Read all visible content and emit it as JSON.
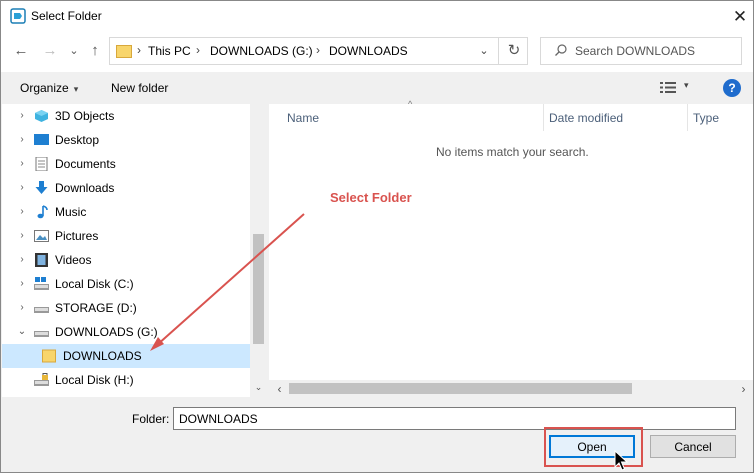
{
  "window": {
    "title": "Select Folder",
    "close_glyph": "✕"
  },
  "nav": {
    "back": "←",
    "forward": "→",
    "history": "⌄",
    "up": "↑",
    "breadcrumbs": [
      "This PC",
      "DOWNLOADS (G:)",
      "DOWNLOADS"
    ],
    "separator": "›",
    "address_drop": "⌄",
    "refresh": "↻",
    "search_placeholder": "Search DOWNLOADS"
  },
  "toolbar": {
    "organize": "Organize",
    "organize_caret": "▾",
    "new_folder": "New folder",
    "view_caret": "▾",
    "help": "?"
  },
  "tree": [
    {
      "label": "3D Objects",
      "icon": "3d-objects-icon",
      "expander": "›"
    },
    {
      "label": "Desktop",
      "icon": "desktop-icon",
      "expander": "›"
    },
    {
      "label": "Documents",
      "icon": "documents-icon",
      "expander": "›"
    },
    {
      "label": "Downloads",
      "icon": "downloads-icon",
      "expander": "›"
    },
    {
      "label": "Music",
      "icon": "music-icon",
      "expander": "›"
    },
    {
      "label": "Pictures",
      "icon": "pictures-icon",
      "expander": "›"
    },
    {
      "label": "Videos",
      "icon": "videos-icon",
      "expander": "›"
    },
    {
      "label": "Local Disk (C:)",
      "icon": "drive-icon",
      "expander": "›"
    },
    {
      "label": "STORAGE (D:)",
      "icon": "drive-icon",
      "expander": "›"
    },
    {
      "label": "DOWNLOADS (G:)",
      "icon": "drive-icon",
      "expander": "⌄"
    },
    {
      "label": "DOWNLOADS",
      "icon": "folder-icon",
      "expander": "",
      "selected": true
    },
    {
      "label": "Local Disk (H:)",
      "icon": "locked-drive-icon",
      "expander": ""
    }
  ],
  "columns": {
    "name": "Name",
    "date_modified": "Date modified",
    "type": "Type",
    "sort_caret": "^"
  },
  "empty_message": "No items match your search.",
  "annotation": {
    "callout": "Select Folder",
    "color": "#d9534f"
  },
  "footer": {
    "folder_label": "Folder:",
    "folder_value": "DOWNLOADS",
    "open": "Open",
    "cancel": "Cancel"
  },
  "scroll": {
    "up": "⌃",
    "down": "⌄",
    "left": "‹",
    "right": "›"
  },
  "colors": {
    "selection": "#cce8ff",
    "accent": "#0078d7",
    "help": "#1f6ccd",
    "folder": "#f8d56b"
  }
}
